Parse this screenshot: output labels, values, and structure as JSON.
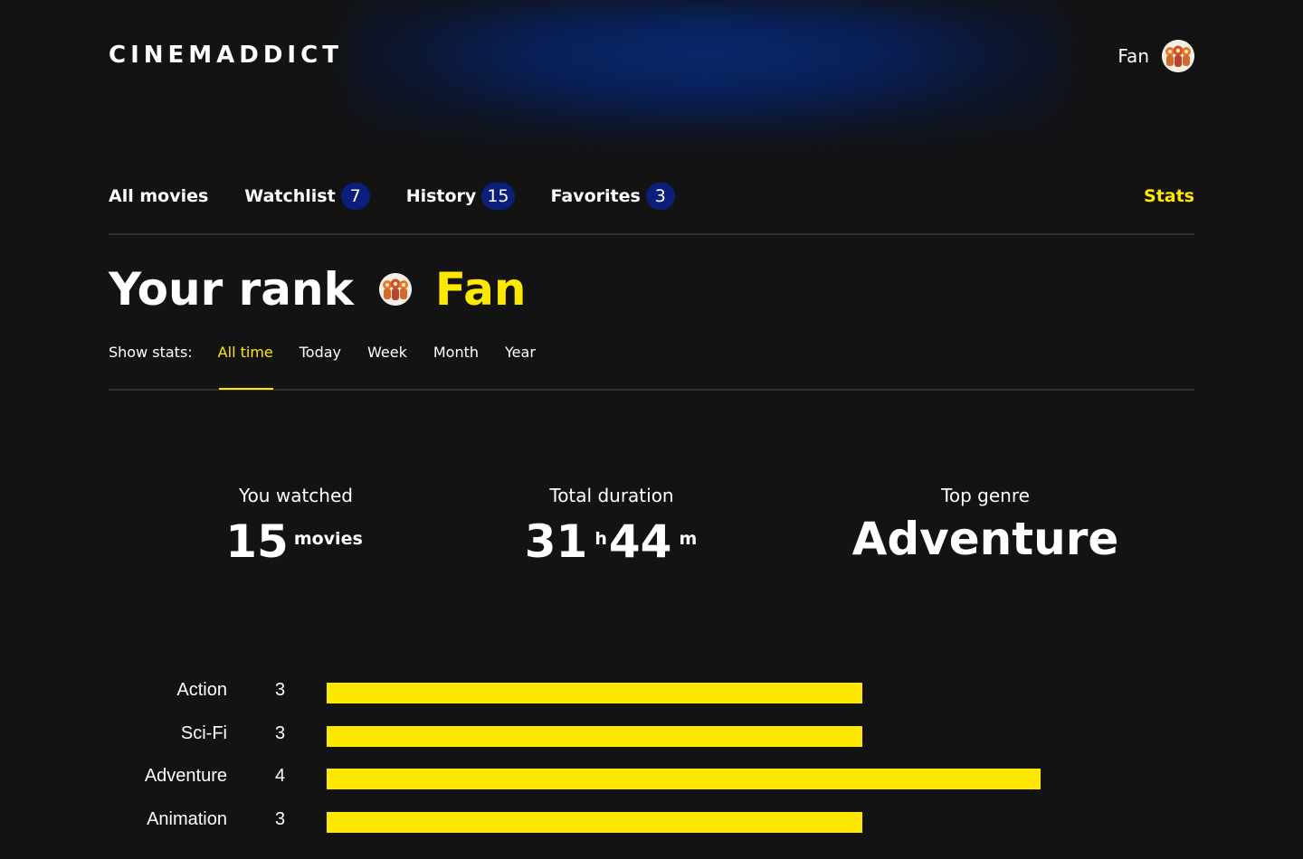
{
  "header": {
    "logo": "CINEMADDICT",
    "profile_rating": "Fan",
    "avatar_icon": "avatar-icon"
  },
  "nav": {
    "items": [
      {
        "label": "All movies"
      },
      {
        "label": "Watchlist",
        "count": "7"
      },
      {
        "label": "History",
        "count": "15"
      },
      {
        "label": "Favorites",
        "count": "3"
      }
    ],
    "stats_label": "Stats"
  },
  "rank": {
    "label": "Your rank",
    "name": "Fan"
  },
  "filters": {
    "label": "Show stats:",
    "options": [
      "All time",
      "Today",
      "Week",
      "Month",
      "Year"
    ],
    "selected": "All time"
  },
  "summary": {
    "watched_title": "You watched",
    "watched_value": "15",
    "watched_unit": "movies",
    "duration_title": "Total duration",
    "duration_hours": "31",
    "duration_hours_unit": "h",
    "duration_minutes": "44",
    "duration_minutes_unit": "m",
    "genre_title": "Top genre",
    "genre_value": "Adventure"
  },
  "colors": {
    "accent": "#ffe800",
    "count_badge": "#0b1f7a",
    "background": "#131313"
  },
  "chart_data": {
    "type": "bar",
    "orientation": "horizontal",
    "categories": [
      "Action",
      "Sci-Fi",
      "Adventure",
      "Animation"
    ],
    "values": [
      3,
      3,
      4,
      3
    ],
    "title": "",
    "xlabel": "",
    "ylabel": "",
    "xlim": [
      0,
      4
    ],
    "grid": false,
    "bar_color": "#ffe800"
  }
}
